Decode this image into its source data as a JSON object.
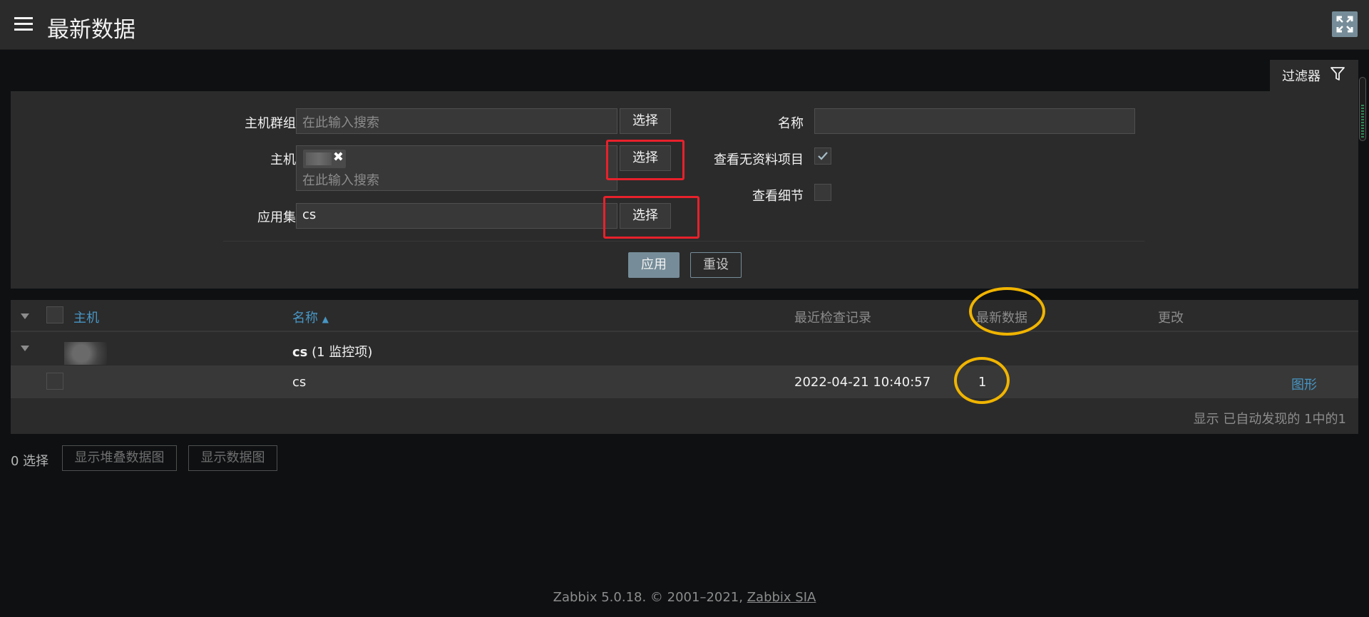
{
  "header": {
    "title": "最新数据",
    "menu_icon": "hamburger-menu-icon",
    "fullscreen_icon": "fullscreen-icon"
  },
  "filter": {
    "tab_label": "过滤器",
    "tab_icon": "funnel-icon",
    "host_groups_label": "主机群组",
    "host_groups_placeholder": "在此输入搜索",
    "hosts_label": "主机",
    "hosts_placeholder": "在此输入搜索",
    "application_label": "应用集",
    "application_value": "cs",
    "select_label": "选择",
    "name_label": "名称",
    "name_value": "",
    "show_without_data_label": "查看无资料项目",
    "show_without_data_checked": true,
    "show_details_label": "查看细节",
    "show_details_checked": false,
    "apply_label": "应用",
    "reset_label": "重设"
  },
  "table": {
    "columns": {
      "host": "主机",
      "name": "名称",
      "last_check": "最近检查记录",
      "last_value": "最新数据",
      "change": "更改"
    },
    "group": {
      "name": "cs",
      "count": "(1 监控项)"
    },
    "rows": [
      {
        "name": "cs",
        "last_check": "2022-04-21 10:40:57",
        "last_value": "1",
        "change": "",
        "action": "图形"
      }
    ],
    "paging": "显示 已自动发现的 1中的1"
  },
  "actions": {
    "selected": "0 选择",
    "stacked_graph": "显示堆叠数据图",
    "graph": "显示数据图"
  },
  "footer": {
    "text": "Zabbix 5.0.18. © 2001–2021,",
    "link": "Zabbix SIA"
  },
  "colors": {
    "accent": "#768d99",
    "link": "#4796c4",
    "annotation_red": "#e8212b",
    "annotation_yellow": "#f0b400"
  }
}
